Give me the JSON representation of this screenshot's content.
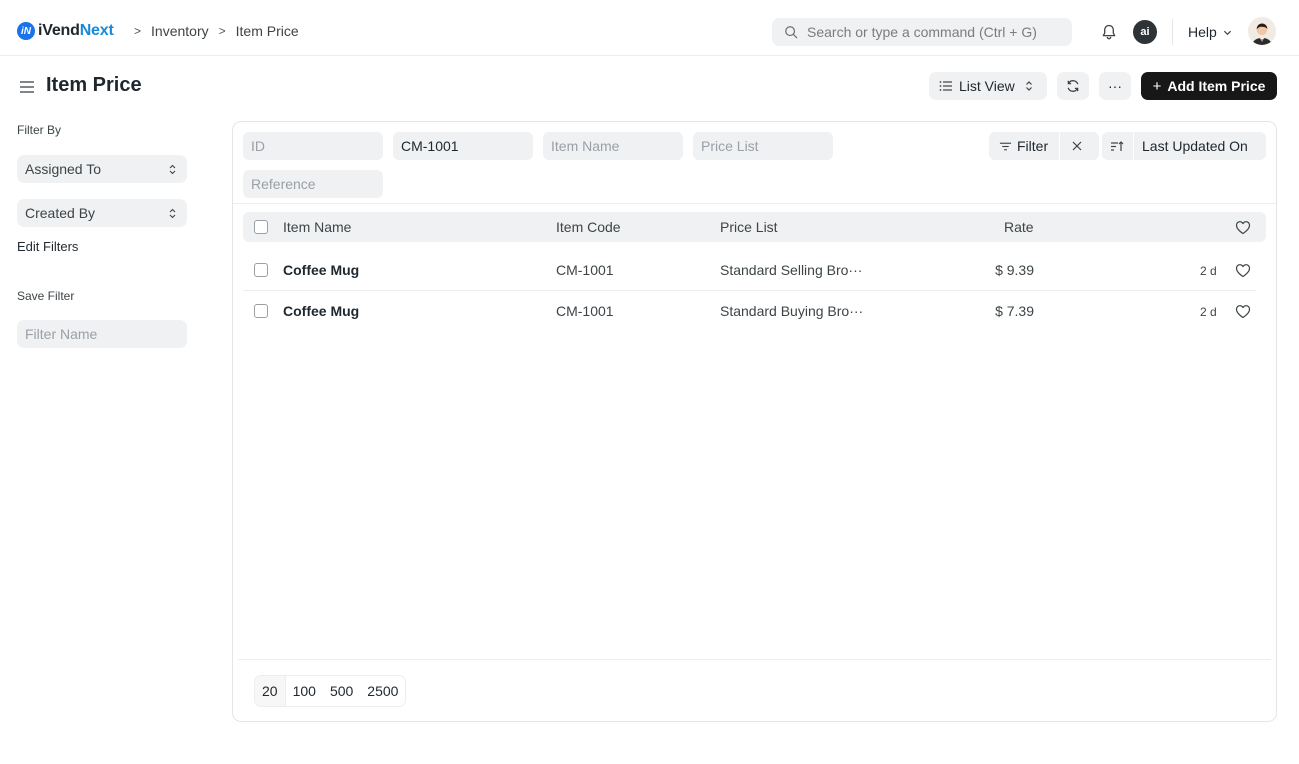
{
  "navbar": {
    "brand": {
      "prefix": "iVend",
      "suffix": "Next",
      "mark": "iN"
    },
    "breadcrumbs": [
      "Inventory",
      "Item Price"
    ],
    "search_placeholder": "Search or type a command (Ctrl + G)",
    "ai_label": "ai",
    "help_label": "Help"
  },
  "page": {
    "title": "Item Price",
    "list_view_label": "List View",
    "add_button_label": "Add Item Price",
    "more_label": "···"
  },
  "sidebar": {
    "filter_by_label": "Filter By",
    "assigned_to": "Assigned To",
    "created_by": "Created By",
    "edit_filters": "Edit Filters",
    "save_filter_label": "Save Filter",
    "filter_name_placeholder": "Filter Name"
  },
  "filters": {
    "id_placeholder": "ID",
    "item_code_value": "CM-1001",
    "item_name_placeholder": "Item Name",
    "price_list_placeholder": "Price List",
    "reference_placeholder": "Reference",
    "filter_label": "Filter",
    "sort_label": "Last Updated On"
  },
  "table": {
    "columns": [
      "Item Name",
      "Item Code",
      "Price List",
      "Rate"
    ],
    "rows": [
      {
        "item_name": "Coffee Mug",
        "item_code": "CM-1001",
        "price_list": "Standard Selling Bro···",
        "rate": "$ 9.39",
        "modified": "2 d"
      },
      {
        "item_name": "Coffee Mug",
        "item_code": "CM-1001",
        "price_list": "Standard Buying Bro···",
        "rate": "$ 7.39",
        "modified": "2 d"
      }
    ]
  },
  "pagination": {
    "sizes": [
      "20",
      "100",
      "500",
      "2500"
    ],
    "selected": "20"
  },
  "colors": {
    "primary_button": "#171717",
    "brand_blue": "#1a8ad8",
    "control_bg": "#f0f1f2"
  }
}
